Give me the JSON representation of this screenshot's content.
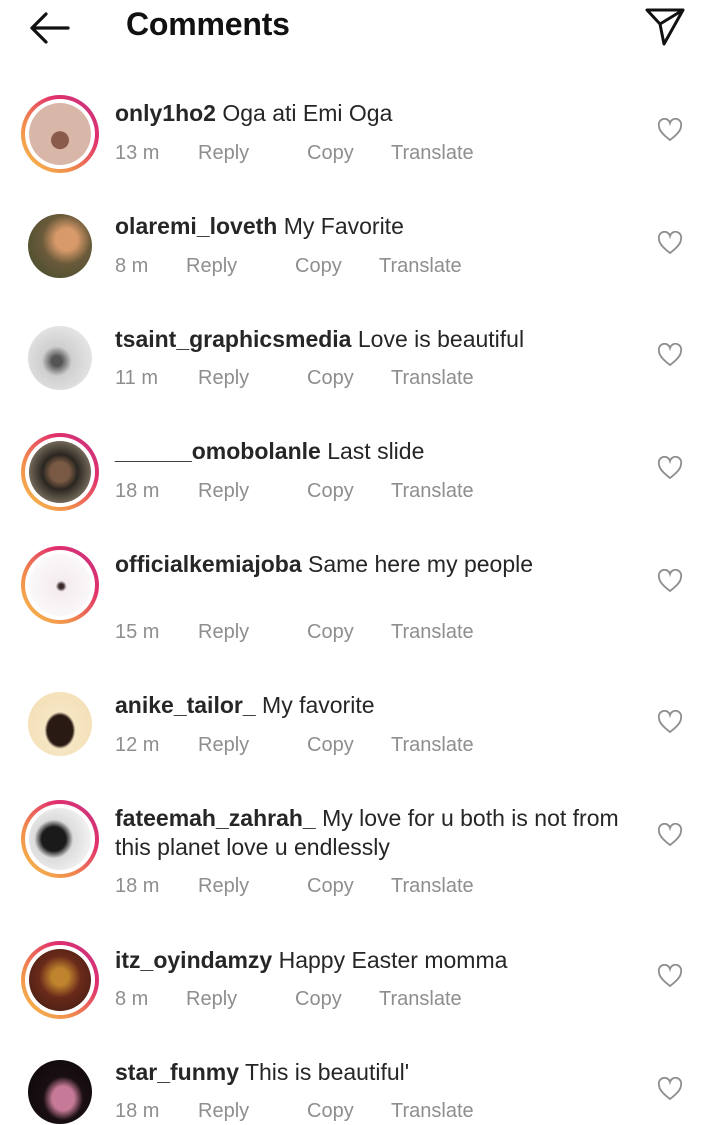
{
  "header": {
    "title": "Comments",
    "back_icon": "back-arrow-icon",
    "share_icon": "send-icon"
  },
  "actions": {
    "reply": "Reply",
    "copy": "Copy",
    "translate": "Translate"
  },
  "comments": [
    {
      "username": "only1ho2",
      "text": "Oga ati Emi Oga",
      "time": "13 m",
      "ring": true
    },
    {
      "username": "olaremi_loveth",
      "text": "My Favorite",
      "time": "8 m",
      "ring": false
    },
    {
      "username": "tsaint_graphicsmedia",
      "text": "Love is beautiful",
      "time": "11 m",
      "ring": false
    },
    {
      "username": "______omobolanle",
      "text": "Last slide",
      "time": "18 m",
      "ring": true
    },
    {
      "username": "officialkemiajoba",
      "text": "Same here my people",
      "time": "15 m",
      "ring": true
    },
    {
      "username": "anike_tailor_",
      "text": "My favorite",
      "time": "12 m",
      "ring": false
    },
    {
      "username": "fateemah_zahrah_",
      "text": "My love for u both is not from this planet love u endlessly",
      "time": "18 m",
      "ring": true
    },
    {
      "username": "itz_oyindamzy",
      "text": "Happy Easter momma",
      "time": "8 m",
      "ring": true
    },
    {
      "username": "star_funmy",
      "text": "This is beautiful'",
      "time": "18 m",
      "ring": false
    }
  ]
}
